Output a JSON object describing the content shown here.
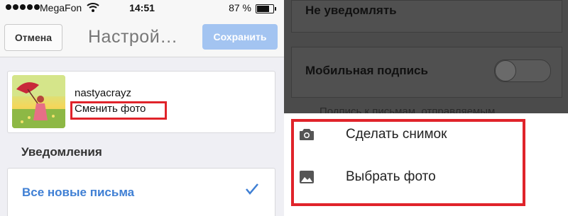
{
  "status_bar": {
    "carrier": "MegaFon",
    "time": "14:51",
    "battery": "87 %",
    "battery_level": 0.87
  },
  "nav": {
    "cancel_label": "Отмена",
    "title": "Настрой…",
    "save_label": "Сохранить"
  },
  "profile": {
    "username": "nastyacrayz",
    "change_photo": "Сменить фото"
  },
  "notifications": {
    "section_title": "Уведомления",
    "selected_option": "Все новые письма"
  },
  "background_settings": {
    "option_mute": "Не уведомлять",
    "mobile_signature_label": "Мобильная подпись",
    "signature_toggle_on": false,
    "signature_hint": "Подпись к письмам, отправляемым"
  },
  "photo_sheet": {
    "take_photo": "Сделать снимок",
    "choose_photo": "Выбрать фото"
  },
  "icons": {
    "camera": "camera-icon",
    "image": "image-icon",
    "check": "check-icon"
  },
  "colors": {
    "highlight": "#e0232a",
    "accent_blue": "#3f7fd4",
    "save_button": "#a3c4f1"
  }
}
